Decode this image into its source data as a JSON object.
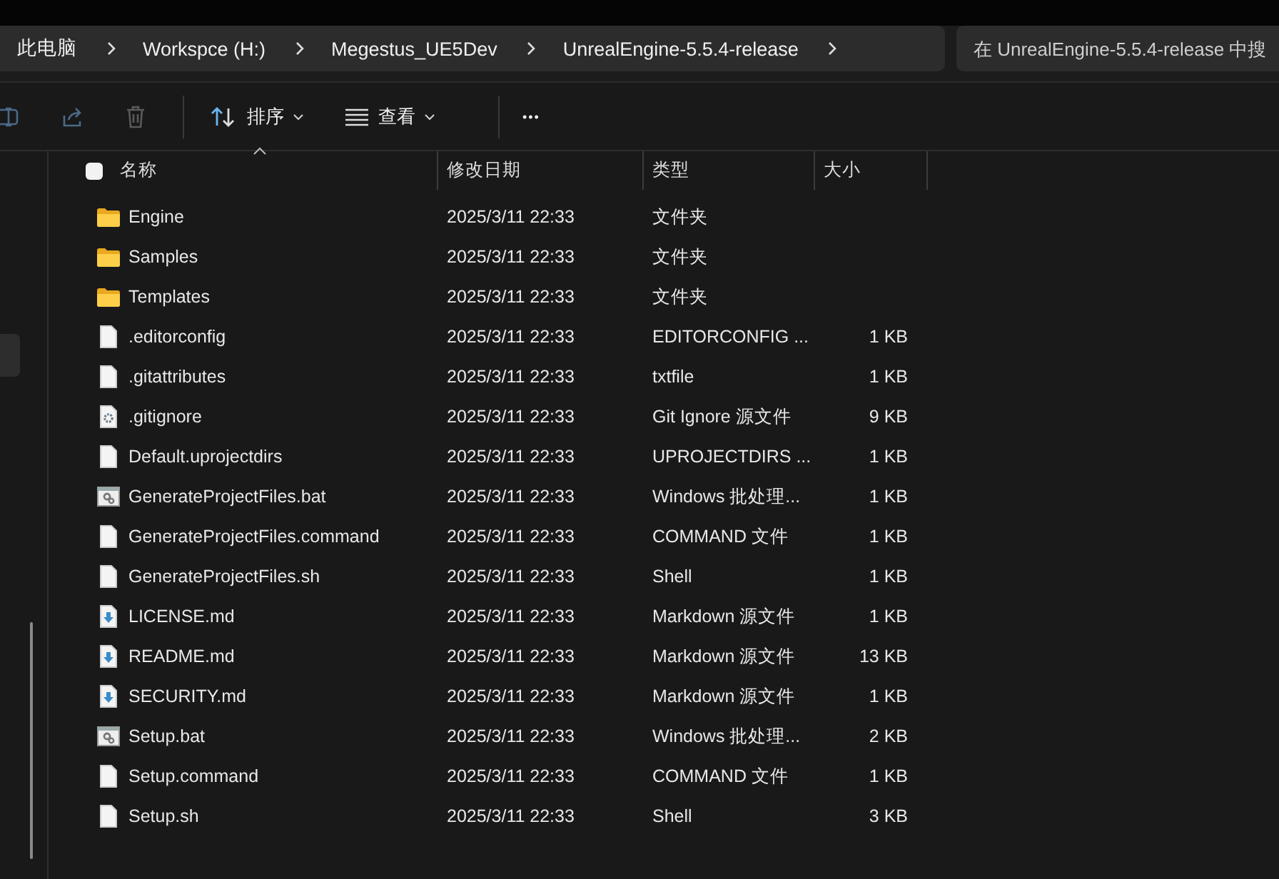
{
  "breadcrumb": [
    "此电脑",
    "Workspce (H:)",
    "Megestus_UE5Dev",
    "UnrealEngine-5.5.4-release"
  ],
  "search": {
    "placeholder": "在 UnrealEngine-5.5.4-release 中搜"
  },
  "toolbar": {
    "sort": "排序",
    "view": "查看",
    "more": "•••"
  },
  "table": {
    "select_all": {
      "checked": false
    },
    "columns": [
      {
        "label": "名称",
        "sorted": true
      },
      {
        "label": "修改日期",
        "sorted": false
      },
      {
        "label": "类型",
        "sorted": false
      },
      {
        "label": "大小",
        "sorted": false
      }
    ],
    "rows": [
      {
        "kind": "folder",
        "name": "Engine",
        "date": "2025/3/11 22:33",
        "type": "文件夹"
      },
      {
        "kind": "folder",
        "name": "Samples",
        "date": "2025/3/11 22:33",
        "type": "文件夹"
      },
      {
        "kind": "folder",
        "name": "Templates",
        "date": "2025/3/11 22:33",
        "type": "文件夹"
      },
      {
        "kind": "document",
        "name": ".editorconfig",
        "date": "2025/3/11 22:33",
        "type": "EDITORCONFIG ...",
        "size": "1 KB"
      },
      {
        "kind": "document",
        "name": ".gitattributes",
        "date": "2025/3/11 22:33",
        "type": "txtfile",
        "size": "1 KB"
      },
      {
        "kind": "config",
        "name": ".gitignore",
        "date": "2025/3/11 22:33",
        "type": "Git Ignore 源文件",
        "size": "9 KB"
      },
      {
        "kind": "document",
        "name": "Default.uprojectdirs",
        "date": "2025/3/11 22:33",
        "type": "UPROJECTDIRS ...",
        "size": "1 KB"
      },
      {
        "kind": "batch",
        "name": "GenerateProjectFiles.bat",
        "date": "2025/3/11 22:33",
        "type": "Windows 批处理...",
        "size": "1 KB"
      },
      {
        "kind": "document",
        "name": "GenerateProjectFiles.command",
        "date": "2025/3/11 22:33",
        "type": "COMMAND 文件",
        "size": "1 KB"
      },
      {
        "kind": "document",
        "name": "GenerateProjectFiles.sh",
        "date": "2025/3/11 22:33",
        "type": "Shell",
        "size": "1 KB"
      },
      {
        "kind": "markdown",
        "name": "LICENSE.md",
        "date": "2025/3/11 22:33",
        "type": "Markdown 源文件",
        "size": "1 KB"
      },
      {
        "kind": "markdown",
        "name": "README.md",
        "date": "2025/3/11 22:33",
        "type": "Markdown 源文件",
        "size": "13 KB"
      },
      {
        "kind": "markdown",
        "name": "SECURITY.md",
        "date": "2025/3/11 22:33",
        "type": "Markdown 源文件",
        "size": "1 KB"
      },
      {
        "kind": "batch",
        "name": "Setup.bat",
        "date": "2025/3/11 22:33",
        "type": "Windows 批处理...",
        "size": "2 KB"
      },
      {
        "kind": "document",
        "name": "Setup.command",
        "date": "2025/3/11 22:33",
        "type": "COMMAND 文件",
        "size": "1 KB"
      },
      {
        "kind": "document",
        "name": "Setup.sh",
        "date": "2025/3/11 22:33",
        "type": "Shell",
        "size": "3 KB"
      }
    ]
  }
}
